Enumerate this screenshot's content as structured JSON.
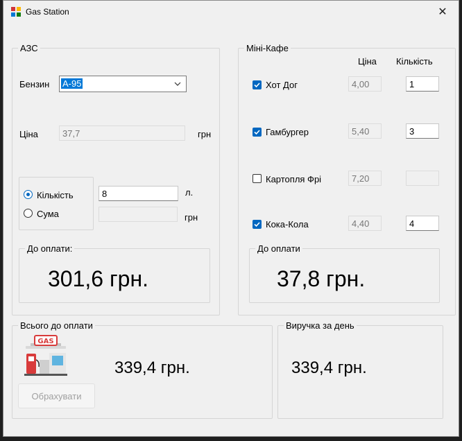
{
  "window": {
    "title": "Gas Station",
    "close_glyph": "✕"
  },
  "azs": {
    "legend": "АЗС",
    "fuel_label": "Бензин",
    "fuel_selected": "А-95",
    "price_label": "Ціна",
    "price_value": "37,7",
    "price_unit": "грн",
    "qty_radio_label": "Кількість",
    "sum_radio_label": "Сума",
    "qty_value": "8",
    "qty_unit": "л.",
    "sum_value": "",
    "sum_unit": "грн",
    "pay_legend": "До оплати:",
    "pay_value": "301,6 грн."
  },
  "cafe": {
    "legend": "Міні-Кафе",
    "price_header": "Ціна",
    "qty_header": "Кількість",
    "items": [
      {
        "name": "Хот Дог",
        "price": "4,00",
        "qty": "1",
        "checked": true
      },
      {
        "name": "Гамбургер",
        "price": "5,40",
        "qty": "3",
        "checked": true
      },
      {
        "name": "Картопля Фрі",
        "price": "7,20",
        "qty": "",
        "checked": false
      },
      {
        "name": "Кока-Кола",
        "price": "4,40",
        "qty": "4",
        "checked": true
      }
    ],
    "pay_legend": "До оплати",
    "pay_value": "37,8 грн."
  },
  "total": {
    "legend": "Всього до оплати",
    "value": "339,4 грн.",
    "calc_button": "Обрахувати",
    "logo_text": "GAS"
  },
  "revenue": {
    "legend": "Виручка за день",
    "value": "339,4 грн."
  }
}
